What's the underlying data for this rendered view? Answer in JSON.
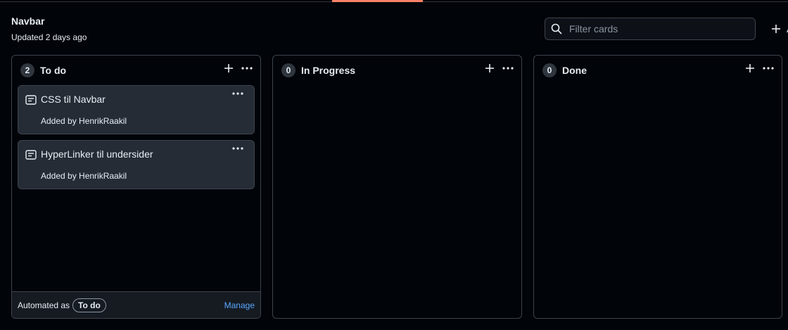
{
  "header": {
    "project_title": "Navbar",
    "updated": "Updated 2 days ago",
    "filter_placeholder": "Filter cards",
    "add_column_label": "A"
  },
  "columns": [
    {
      "title": "To do",
      "count": "2",
      "cards": [
        {
          "title": "CSS til Navbar",
          "meta": "Added by HenrikRaakil"
        },
        {
          "title": "HyperLinker til undersider",
          "meta": "Added by HenrikRaakil"
        }
      ],
      "footer": {
        "automated_label": "Automated as",
        "automated_value": "To do",
        "manage_label": "Manage"
      }
    },
    {
      "title": "In Progress",
      "count": "0",
      "cards": []
    },
    {
      "title": "Done",
      "count": "0",
      "cards": []
    }
  ],
  "colors": {
    "background": "#010409",
    "card": "#262c36",
    "border": "#3d444d",
    "accent": "#f78166",
    "link": "#58a6ff"
  },
  "icons": [
    "search-icon",
    "plus-icon",
    "kebab-icon",
    "note-icon"
  ]
}
